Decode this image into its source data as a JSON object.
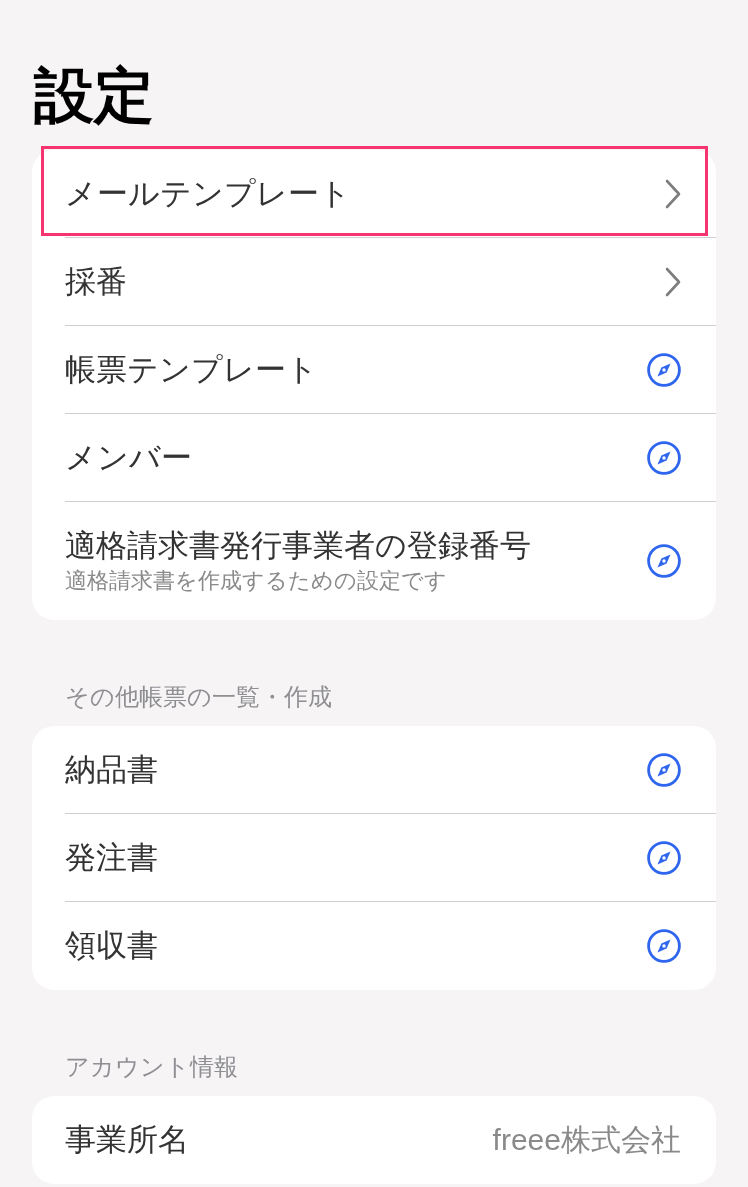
{
  "title": "設定",
  "sections": [
    {
      "items": [
        {
          "label": "メールテンプレート",
          "kind": "chevron",
          "highlighted": true
        },
        {
          "label": "採番",
          "kind": "chevron",
          "highlighted": false
        },
        {
          "label": "帳票テンプレート",
          "kind": "compass",
          "highlighted": false
        },
        {
          "label": "メンバー",
          "kind": "compass",
          "highlighted": false
        },
        {
          "label": "適格請求書発行事業者の登録番号",
          "description": "適格請求書を作成するための設定です",
          "kind": "compass",
          "highlighted": false
        }
      ]
    },
    {
      "header": "その他帳票の一覧・作成",
      "items": [
        {
          "label": "納品書",
          "kind": "compass",
          "highlighted": false
        },
        {
          "label": "発注書",
          "kind": "compass",
          "highlighted": false
        },
        {
          "label": "領収書",
          "kind": "compass",
          "highlighted": false
        }
      ]
    },
    {
      "header": "アカウント情報",
      "items": [
        {
          "label": "事業所名",
          "value": "freee株式会社",
          "kind": "value",
          "highlighted": false
        }
      ]
    }
  ]
}
